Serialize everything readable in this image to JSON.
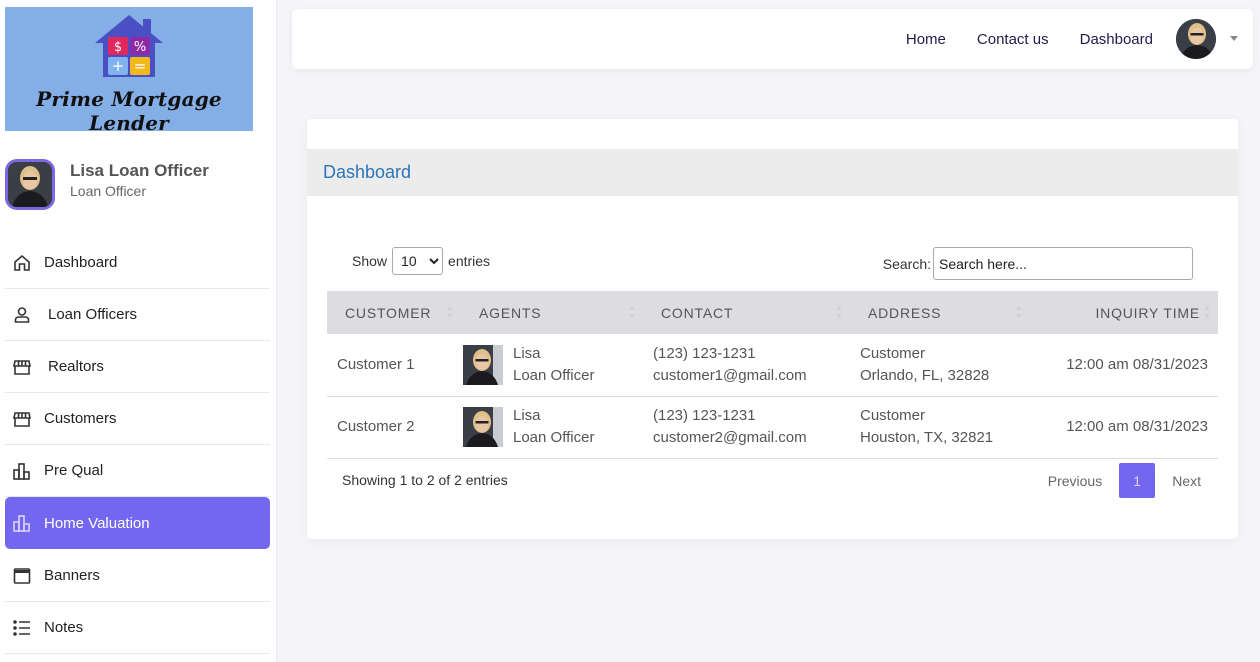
{
  "brand": {
    "name": "Prime Mortgage Lender",
    "logo_symbols": [
      "$",
      "%",
      "+",
      "="
    ],
    "logo_bg": "#84aee6"
  },
  "profile": {
    "name": "Lisa Loan Officer",
    "role": "Loan Officer"
  },
  "sidebar": {
    "items": [
      {
        "label": "Dashboard",
        "icon": "home-icon",
        "active": false
      },
      {
        "label": "Loan Officers",
        "icon": "user-icon",
        "active": false
      },
      {
        "label": "Realtors",
        "icon": "store-icon",
        "active": false
      },
      {
        "label": "Customers",
        "icon": "store-icon",
        "active": false
      },
      {
        "label": "Pre Qual",
        "icon": "bar-chart-icon",
        "active": false
      },
      {
        "label": "Home Valuation",
        "icon": "bar-chart-icon",
        "active": true
      },
      {
        "label": "Banners",
        "icon": "window-icon",
        "active": false
      },
      {
        "label": "Notes",
        "icon": "list-icon",
        "active": false
      }
    ]
  },
  "topbar": {
    "links": [
      "Home",
      "Contact us",
      "Dashboard"
    ]
  },
  "card": {
    "title": "Dashboard"
  },
  "table_controls": {
    "show_label": "Show",
    "entries_label": "entries",
    "page_length": "10",
    "search_label": "Search:",
    "search_placeholder": "Search here..."
  },
  "table": {
    "columns": [
      "CUSTOMER",
      "AGENTS",
      "CONTACT",
      "ADDRESS",
      "INQUIRY TIME"
    ],
    "rows": [
      {
        "customer": "Customer 1",
        "agent_name": "Lisa",
        "agent_role": "Loan Officer",
        "phone": "(123) 123-1231",
        "email": "customer1@gmail.com",
        "address_line1": "Customer",
        "address_line2": "Orlando, FL, 32828",
        "inquiry_time": "12:00 am 08/31/2023"
      },
      {
        "customer": "Customer 2",
        "agent_name": "Lisa",
        "agent_role": "Loan Officer",
        "phone": "(123) 123-1231",
        "email": "customer2@gmail.com",
        "address_line1": "Customer",
        "address_line2": "Houston, TX, 32821",
        "inquiry_time": "12:00 am 08/31/2023"
      }
    ]
  },
  "footer": {
    "info": "Showing 1 to 2 of 2 entries",
    "previous": "Previous",
    "current_page": "1",
    "next": "Next"
  },
  "colors": {
    "accent": "#7367f0",
    "title_blue": "#2a76b8",
    "nav_text": "#1f1d4d"
  }
}
